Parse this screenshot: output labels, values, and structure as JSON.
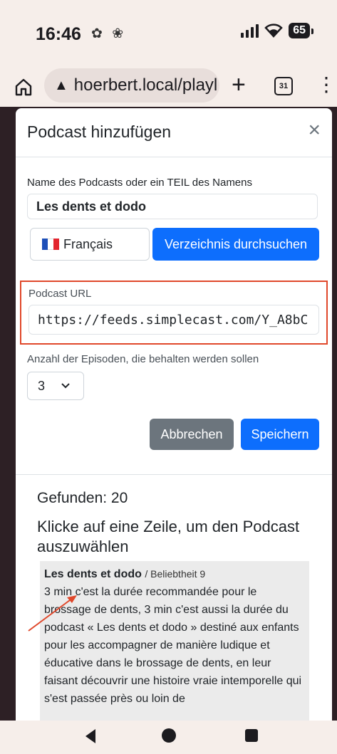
{
  "status": {
    "time": "16:46",
    "battery": "65",
    "left_icons": "✿ ❀"
  },
  "browser": {
    "url": "hoerbert.local/playl",
    "tab_count": "31",
    "plus": "+",
    "menu": "⋮"
  },
  "modal": {
    "title": "Podcast hinzufügen",
    "close": "×",
    "name_label": "Name des Podcasts oder ein TEIL des Namens",
    "name_value": "Les dents et dodo",
    "language": "Français",
    "search_button": "Verzeichnis durchsuchen",
    "url_label": "Podcast URL",
    "url_value": "https://feeds.simplecast.com/Y_A8bC",
    "episodes_label": "Anzahl der Episoden, die behalten werden sollen",
    "episodes_value": "3",
    "cancel_button": "Abbrechen",
    "save_button": "Speichern",
    "found": "Gefunden: 20",
    "instruction": "Klicke auf eine Zeile, um den Podcast auszuwählen"
  },
  "result": {
    "title": "Les dents et dodo",
    "popularity": "/ Beliebtheit 9",
    "description": "3 min c'est la durée recommandée pour le brossage de dents, 3 min c'est aussi la durée du podcast « Les dents et dodo » destiné aux enfants pour les accompagner de manière ludique et éducative dans le brossage de dents, en leur faisant découvrir une histoire vraie intemporelle qui s'est passée près ou loin de"
  },
  "colors": {
    "primary": "#0d6efd",
    "secondary": "#6c757d",
    "highlight": "#e0482b",
    "page_bg": "#2d2025"
  }
}
